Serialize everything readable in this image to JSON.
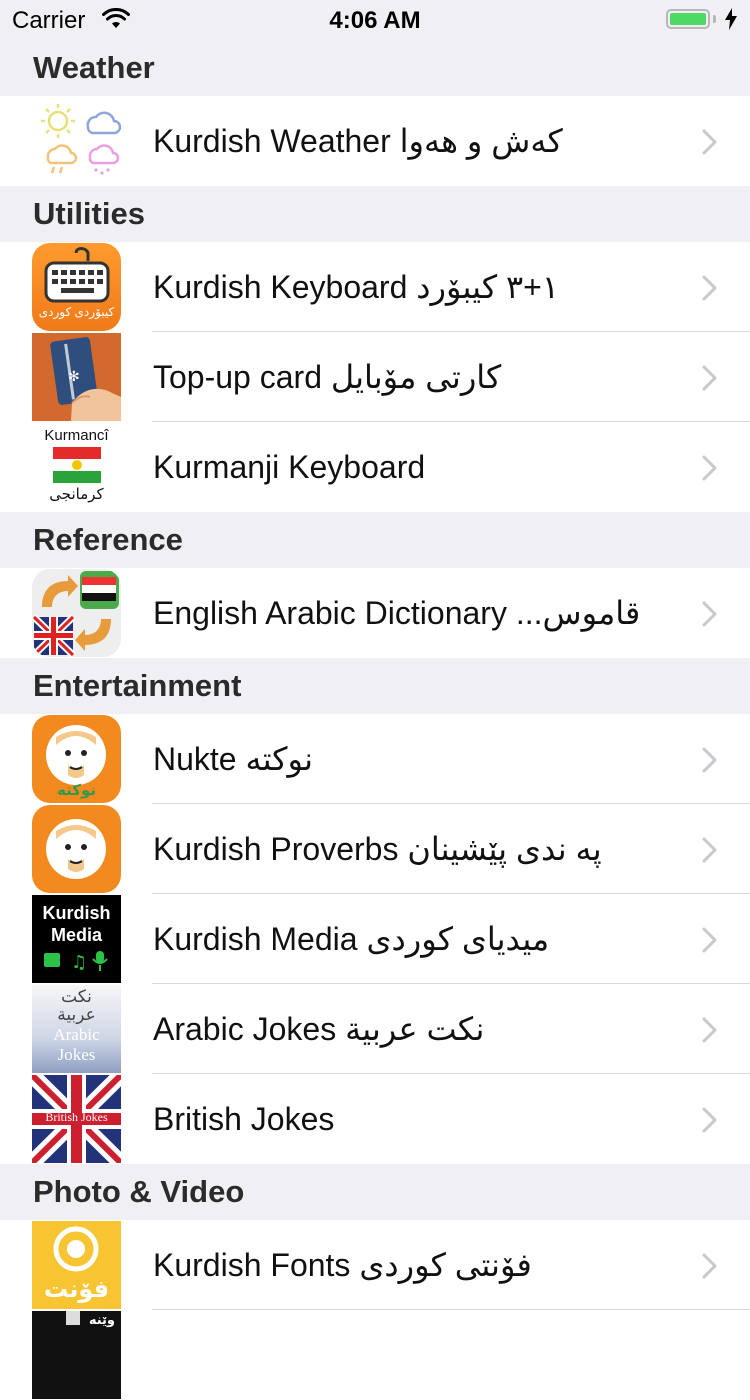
{
  "status_bar": {
    "carrier": "Carrier",
    "time": "4:06 AM"
  },
  "sections": [
    {
      "header": "Weather",
      "rows": [
        {
          "title": "Kurdish Weather کەش و هەوا",
          "icon": "weather-icon"
        }
      ]
    },
    {
      "header": "Utilities",
      "rows": [
        {
          "title": "Kurdish Keyboard ١+٣ کیبۆرد",
          "icon": "keyboard-icon",
          "icon_text": "کیبۆردی کوردی"
        },
        {
          "title": "Top-up card کارتی مۆبایل",
          "icon": "topup-card-icon"
        },
        {
          "title": "Kurmanji Keyboard",
          "icon": "kurmanji-flag-icon",
          "icon_text_top": "Kurmancî",
          "icon_text_bottom": "کرمانجی"
        }
      ]
    },
    {
      "header": "Reference",
      "rows": [
        {
          "title": "English Arabic Dictionary ...قاموس",
          "icon": "dictionary-flags-icon"
        }
      ]
    },
    {
      "header": "Entertainment",
      "rows": [
        {
          "title": "Nukte نوکتە",
          "icon": "nukte-face-icon",
          "icon_text": "نوکتە"
        },
        {
          "title": "Kurdish Proverbs پە ندی پێشینان",
          "icon": "proverbs-face-icon"
        },
        {
          "title": "Kurdish Media میدیای کوردی",
          "icon": "media-icon",
          "icon_text_top": "Kurdish",
          "icon_text_mid": "Media"
        },
        {
          "title": "Arabic Jokes نکت عربية",
          "icon": "arabic-jokes-icon",
          "icon_lines": [
            "نكت",
            "عربية",
            "Arabic",
            "Jokes"
          ]
        },
        {
          "title": "British Jokes",
          "icon": "union-jack-icon",
          "icon_text": "British Jokes"
        }
      ]
    },
    {
      "header": "Photo & Video",
      "rows": [
        {
          "title": "Kurdish Fonts فۆنتی کوردی",
          "icon": "fonts-icon",
          "icon_text": "فۆنت"
        },
        {
          "title": "",
          "icon": "partial-app-icon",
          "icon_text": "وێنە"
        }
      ]
    }
  ]
}
